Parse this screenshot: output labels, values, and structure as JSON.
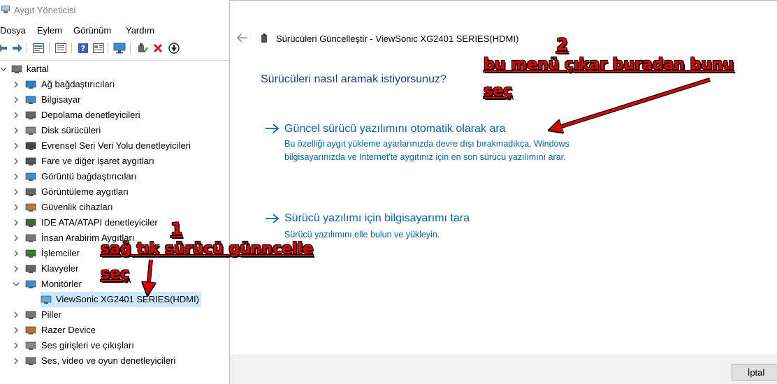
{
  "device_manager": {
    "title": "Aygıt Yöneticisi",
    "menu": [
      "Dosya",
      "Eylem",
      "Görünüm",
      "Yardım"
    ],
    "toolbar_icons": [
      "back-arrow-icon",
      "forward-arrow-icon",
      "properties-icon",
      "tree-view-icon",
      "help-icon",
      "details-view-icon",
      "monitor-scan-icon",
      "enable-device-icon",
      "uninstall-device-icon",
      "update-driver-icon"
    ],
    "root": "kartal",
    "categories": [
      "Ağ bağdaştırıcıları",
      "Bilgisayar",
      "Depolama denetleyicileri",
      "Disk sürücüleri",
      "Evrensel Seri Veri Yolu denetleyicileri",
      "Fare ve diğer işaret aygıtları",
      "Görüntü bağdaştırıcıları",
      "Görüntüleme aygıtları",
      "Güvenlik cihazları",
      "IDE ATA/ATAPI denetleyiciler",
      "İnsan Arabirim Aygıtları",
      "İşlemciler",
      "Klavyeler",
      "Monitörler"
    ],
    "selected_device": "ViewSonic XG2401 SERIES(HDMI)",
    "categories_after": [
      "Piller",
      "Razer Device",
      "Ses girişleri ve çıkışları",
      "Ses, video ve oyun denetleyicileri"
    ]
  },
  "dialog": {
    "title": "Sürücüleri Güncelleştir - ViewSonic XG2401 SERIES(HDMI)",
    "question": "Sürücüleri nasıl aramak istiyorsunuz?",
    "option1_title": "Güncel sürücü yazılımını otomatik olarak ara",
    "option1_desc_line1": "Bu özelliği aygıt yükleme ayarlarınızda devre dışı bırakmadıkça, Windows",
    "option1_desc_line2": "bilgisayarınızda ve Internet'te aygıtınız için en son sürücü yazılımını arar.",
    "option2_title": "Sürücü yazılımı için bilgisayarımı tara",
    "option2_desc": "Sürücü yazılımını elle bulun ve yükleyin.",
    "cancel_label": "İptal"
  },
  "annotations": {
    "step1_number": "1",
    "step1_line1": "sağ tık sürücü günncelle",
    "step1_line2": "seç",
    "step2_number": "2",
    "step2_line1": "bu menü çıkar buradan bunu",
    "step2_line2": "seç",
    "color": "#e00000"
  },
  "colors": {
    "link_blue": "#0066b4",
    "heading_blue": "#1f3c88",
    "selection": "#cce8ff"
  }
}
